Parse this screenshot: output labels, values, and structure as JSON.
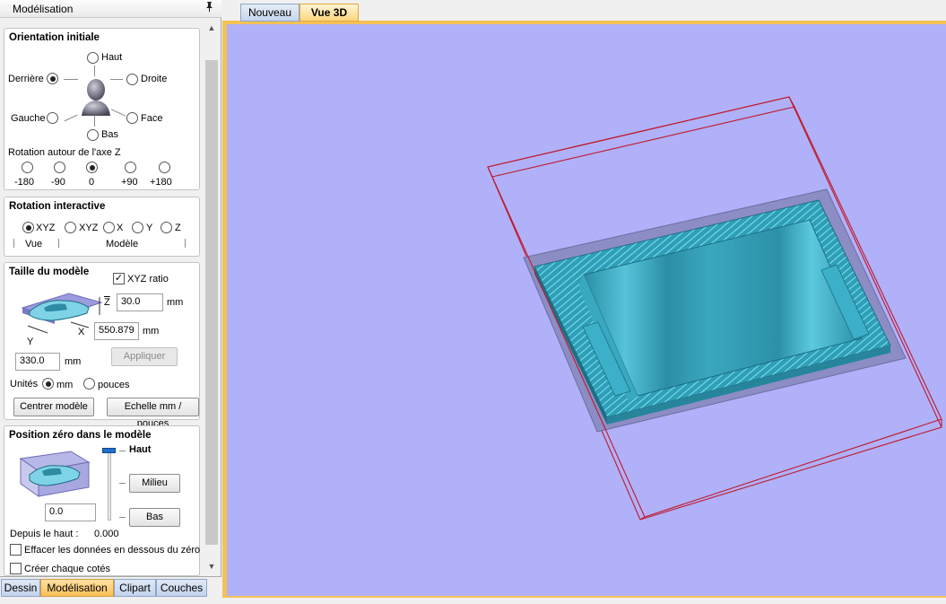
{
  "panel": {
    "title": "Modélisation",
    "pin_icon": "pin-icon"
  },
  "orientation": {
    "title": "Orientation initiale",
    "top": "Haut",
    "back": "Derrière",
    "right": "Droite",
    "left": "Gauche",
    "front": "Face",
    "bottom": "Bas",
    "selected": "Derrière",
    "z_rotation_label": "Rotation autour de l'axe Z",
    "z_options": [
      "-180",
      "-90",
      "0",
      "+90",
      "+180"
    ],
    "z_selected": "0"
  },
  "rotation": {
    "title": "Rotation interactive",
    "options": [
      "XYZ",
      "XYZ",
      "X",
      "Y",
      "Z"
    ],
    "selected": 0,
    "view_label": "Vue",
    "model_label": "Modèle"
  },
  "size": {
    "title": "Taille du modèle",
    "ratio_label": "XYZ ratio",
    "ratio_checked": true,
    "z_axis": "Z",
    "x_axis": "X",
    "y_axis": "Y",
    "z_value": "30.0",
    "x_value": "550.879",
    "y_value": "330.0",
    "unit_mm": "mm",
    "apply_label": "Appliquer",
    "units_label": "Unités",
    "unit_option_mm": "mm",
    "unit_option_in": "pouces",
    "center_label": "Centrer modèle",
    "scale_label": "Echelle mm / pouces"
  },
  "zero": {
    "title": "Position zéro dans le modèle",
    "top_label": "Haut",
    "middle_label": "Milieu",
    "bottom_label": "Bas",
    "value": "0.0",
    "from_top_label": "Depuis le haut :",
    "from_top_value": "0.000",
    "clear_below_label": "Effacer les données en dessous du zéro",
    "each_side_label": "Créer chaque cotés"
  },
  "bottom_tabs": [
    "Dessin",
    "Modélisation",
    "Clipart",
    "Couches"
  ],
  "bottom_tab_active": 1,
  "doc_tabs": [
    "Nouveau",
    "Vue 3D"
  ],
  "doc_tab_active": 1,
  "colors": {
    "viewport_bg": "#b0b1f8",
    "model": "#3fb6cf",
    "bbox": "#c0182c",
    "active_tab": "#f9bf56"
  }
}
